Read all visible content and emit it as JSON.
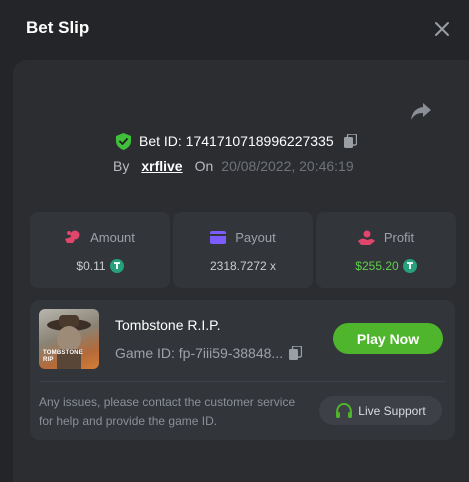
{
  "modal": {
    "title": "Bet Slip"
  },
  "bet": {
    "id_text": "Bet ID: 1741710718996227335",
    "by_label": "By",
    "user": "xrflive",
    "on_label": "On",
    "date": "20/08/2022, 20:46:19"
  },
  "stats": [
    {
      "label": "Amount",
      "value": "$0.11",
      "icon": "coins-icon",
      "color": "#e0456b"
    },
    {
      "label": "Payout",
      "value": "2318.7272 x",
      "icon": "wallet-icon",
      "color": "#7c5cff"
    },
    {
      "label": "Profit",
      "value": "$255.20",
      "icon": "hand-coin-icon",
      "color": "#e0456b"
    }
  ],
  "game": {
    "name": "Tombstone R.I.P.",
    "thumb_text_1": "TOMBSTONE",
    "thumb_text_2": "RIP",
    "game_id": "Game ID: fp-7iii59-38848...",
    "play_label": "Play Now"
  },
  "support": {
    "issues_text": "Any issues, please contact the customer service for help and provide the game ID.",
    "button_label": "Live Support"
  },
  "colors": {
    "accent_green": "#4fb52c",
    "profit_green": "#5fd14a",
    "tether": "#26a17b"
  }
}
